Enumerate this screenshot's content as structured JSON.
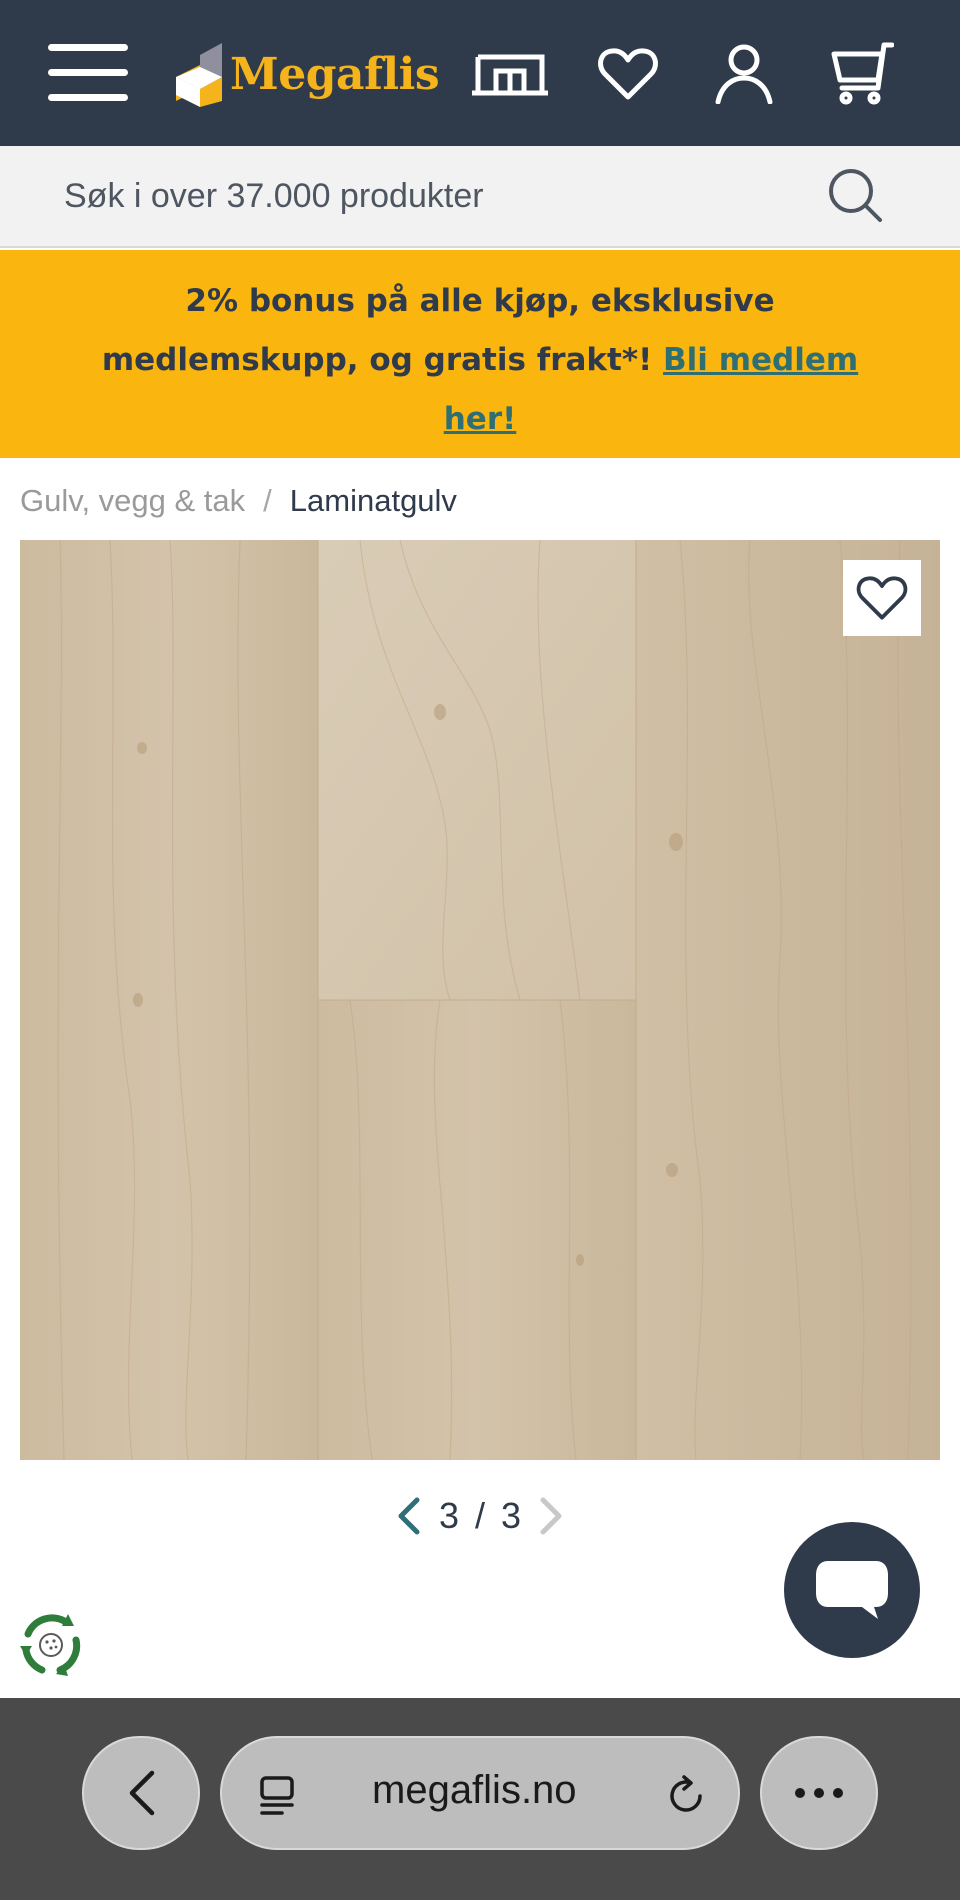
{
  "header": {
    "brand": "Megaflis",
    "icons": [
      "menu-icon",
      "store-icon",
      "heart-icon",
      "user-icon",
      "cart-icon"
    ],
    "background": "#2f3b4b",
    "brand_color": "#f6b41c"
  },
  "search": {
    "placeholder": "Søk i over 37.000 produkter"
  },
  "banner": {
    "text": "2% bonus på alle kjøp, eksklusive medlemskupp, og gratis frakt*! ",
    "link": "Bli medlem her!",
    "background": "#fbb50f"
  },
  "breadcrumb": {
    "parent": "Gulv, vegg & tak",
    "separator": "/",
    "current": "Laminatgulv"
  },
  "gallery": {
    "current": "3",
    "separator": "/",
    "total": "3"
  },
  "browser": {
    "url": "megaflis.no"
  }
}
